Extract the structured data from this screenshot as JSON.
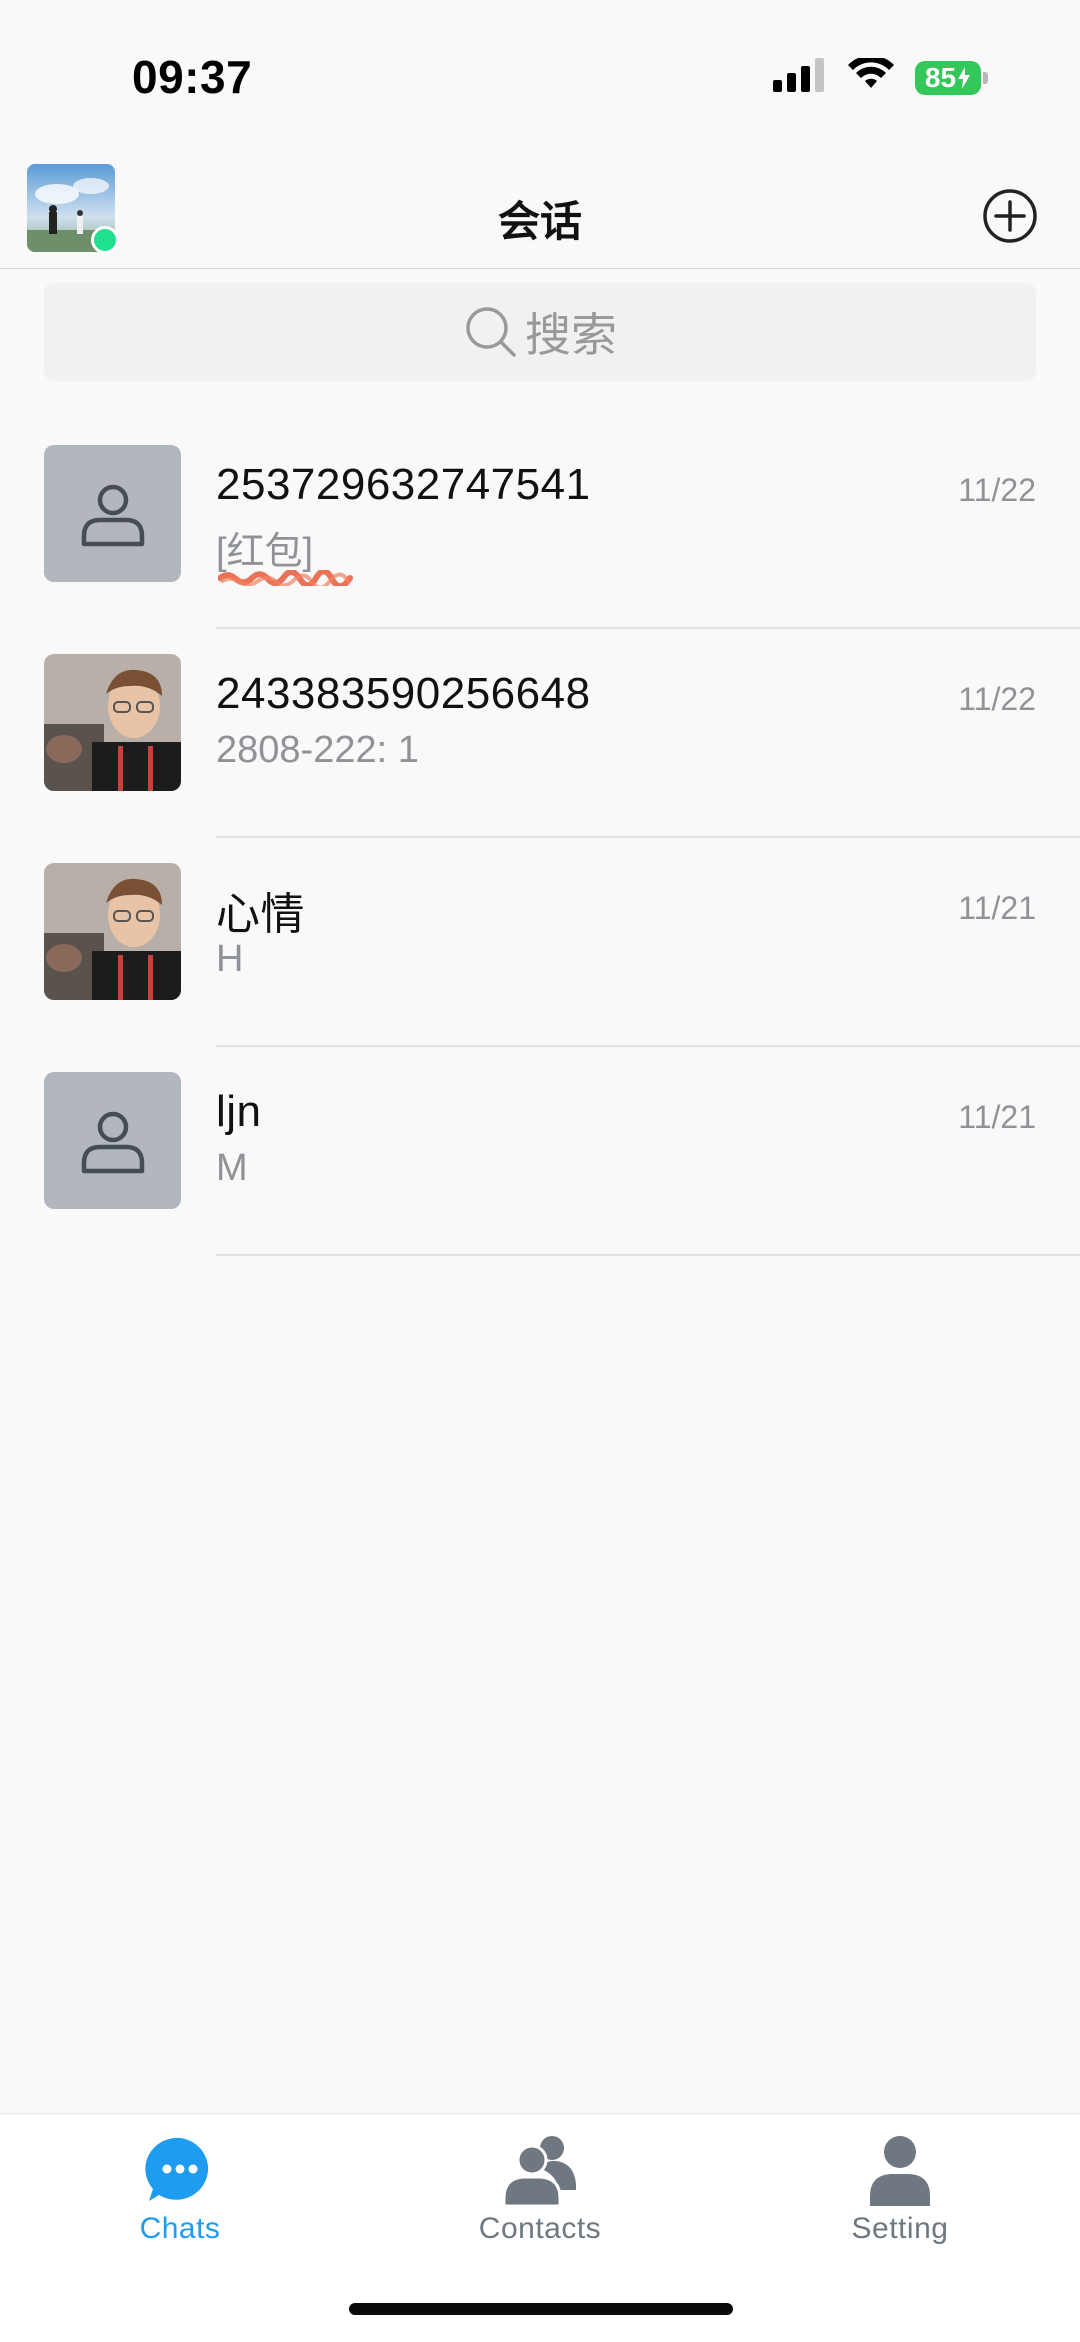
{
  "status_bar": {
    "time": "09:37",
    "battery": "85"
  },
  "header": {
    "title": "会话"
  },
  "search": {
    "placeholder": "搜索"
  },
  "conversations": [
    {
      "name": "253729632747541",
      "preview": "[红包]",
      "time": "11/22",
      "avatar": "default-person"
    },
    {
      "name": "243383590256648",
      "preview": "2808-222: 1",
      "time": "11/22",
      "avatar": "photo"
    },
    {
      "name": "心情",
      "preview": "H",
      "time": "11/21",
      "avatar": "photo"
    },
    {
      "name": "ljn",
      "preview": "M",
      "time": "11/21",
      "avatar": "default-person"
    }
  ],
  "tabs": [
    {
      "label": "Chats",
      "icon": "chat-bubble-icon",
      "active": true
    },
    {
      "label": "Contacts",
      "icon": "contacts-icon",
      "active": false
    },
    {
      "label": "Setting",
      "icon": "person-icon",
      "active": false
    }
  ],
  "colors": {
    "accent": "#1e9cf0",
    "online": "#1fe08f",
    "battery": "#34c759",
    "placeholder_avatar": "#b2b7bd"
  }
}
